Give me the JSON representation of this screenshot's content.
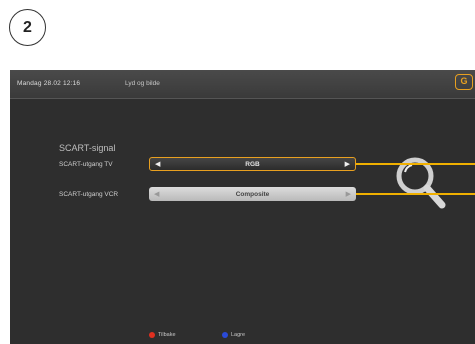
{
  "step_badge": "2",
  "header": {
    "datetime": "Mandag 28.02 12:16",
    "title": "Lyd og bilde",
    "logo_icon": "brand-logo-icon"
  },
  "section": {
    "title": "SCART-signal"
  },
  "rows": [
    {
      "label": "SCART-utgang TV",
      "value": "RGB",
      "state": "selected"
    },
    {
      "label": "SCART-utgang VCR",
      "value": "Composite",
      "state": "normal"
    }
  ],
  "footer": {
    "back": {
      "label": "Tilbake",
      "color": "#e03020"
    },
    "save": {
      "label": "Lagre",
      "color": "#2a4ad8"
    }
  },
  "colors": {
    "accent": "#e8a020",
    "callout": "#f0b000",
    "screen_bg": "#2e2e2e"
  }
}
